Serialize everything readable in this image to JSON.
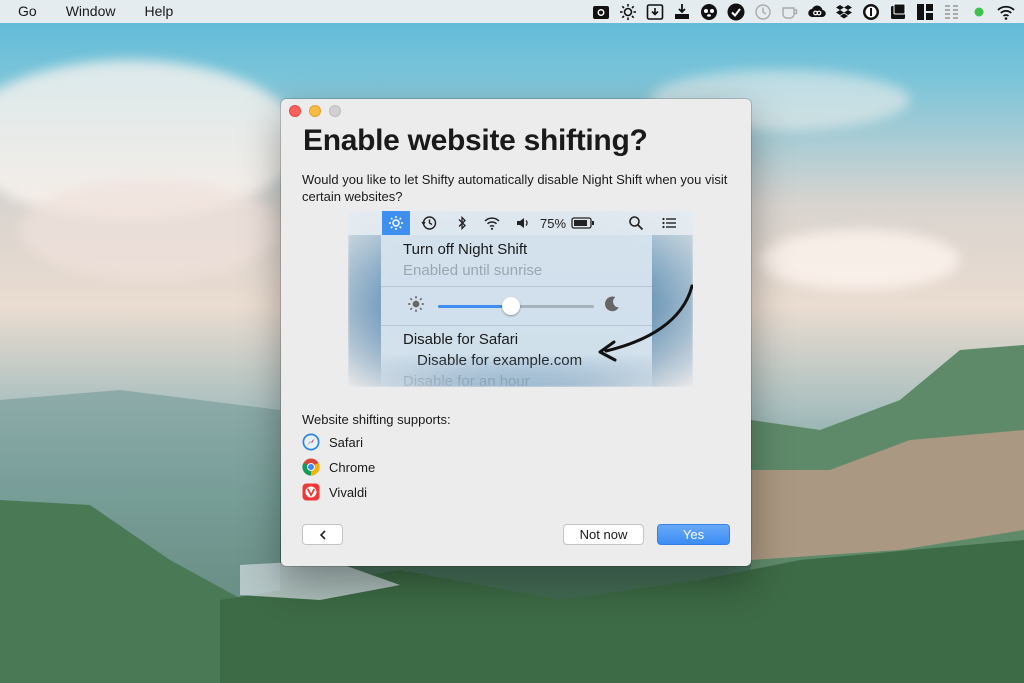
{
  "menubar": {
    "items": [
      "Go",
      "Window",
      "Help"
    ],
    "status_icons": [
      "camera-icon",
      "sun-icon",
      "download-box-icon",
      "install-icon",
      "panda-icon",
      "checkmark-circle-icon",
      "clock-icon",
      "cup-icon",
      "creative-cloud-icon",
      "dropbox-icon",
      "onepassword-icon",
      "folder-icon",
      "grid-icon",
      "battery-levels-icon",
      "green-dot-icon",
      "wifi-icon"
    ]
  },
  "dialog": {
    "title": "Enable website shifting?",
    "description": "Would you like to let Shifty automatically disable Night Shift when you visit certain websites?",
    "illustration": {
      "battery_text": "75%",
      "menu_items": {
        "turn_off": "Turn off Night Shift",
        "enabled_until": "Enabled until sunrise",
        "disable_app": "Disable for Safari",
        "disable_site": "Disable for example.com",
        "disable_hour": "Disable for an hour"
      },
      "slider_value": 0.47
    },
    "supports_label": "Website shifting supports:",
    "browsers": [
      {
        "name": "Safari",
        "icon": "safari-icon"
      },
      {
        "name": "Chrome",
        "icon": "chrome-icon"
      },
      {
        "name": "Vivaldi",
        "icon": "vivaldi-icon"
      }
    ],
    "buttons": {
      "back": "‹",
      "not_now": "Not now",
      "yes": "Yes"
    }
  },
  "colors": {
    "accent": "#3b8df4",
    "close": "#fc605b",
    "minimize": "#fdbc40"
  }
}
